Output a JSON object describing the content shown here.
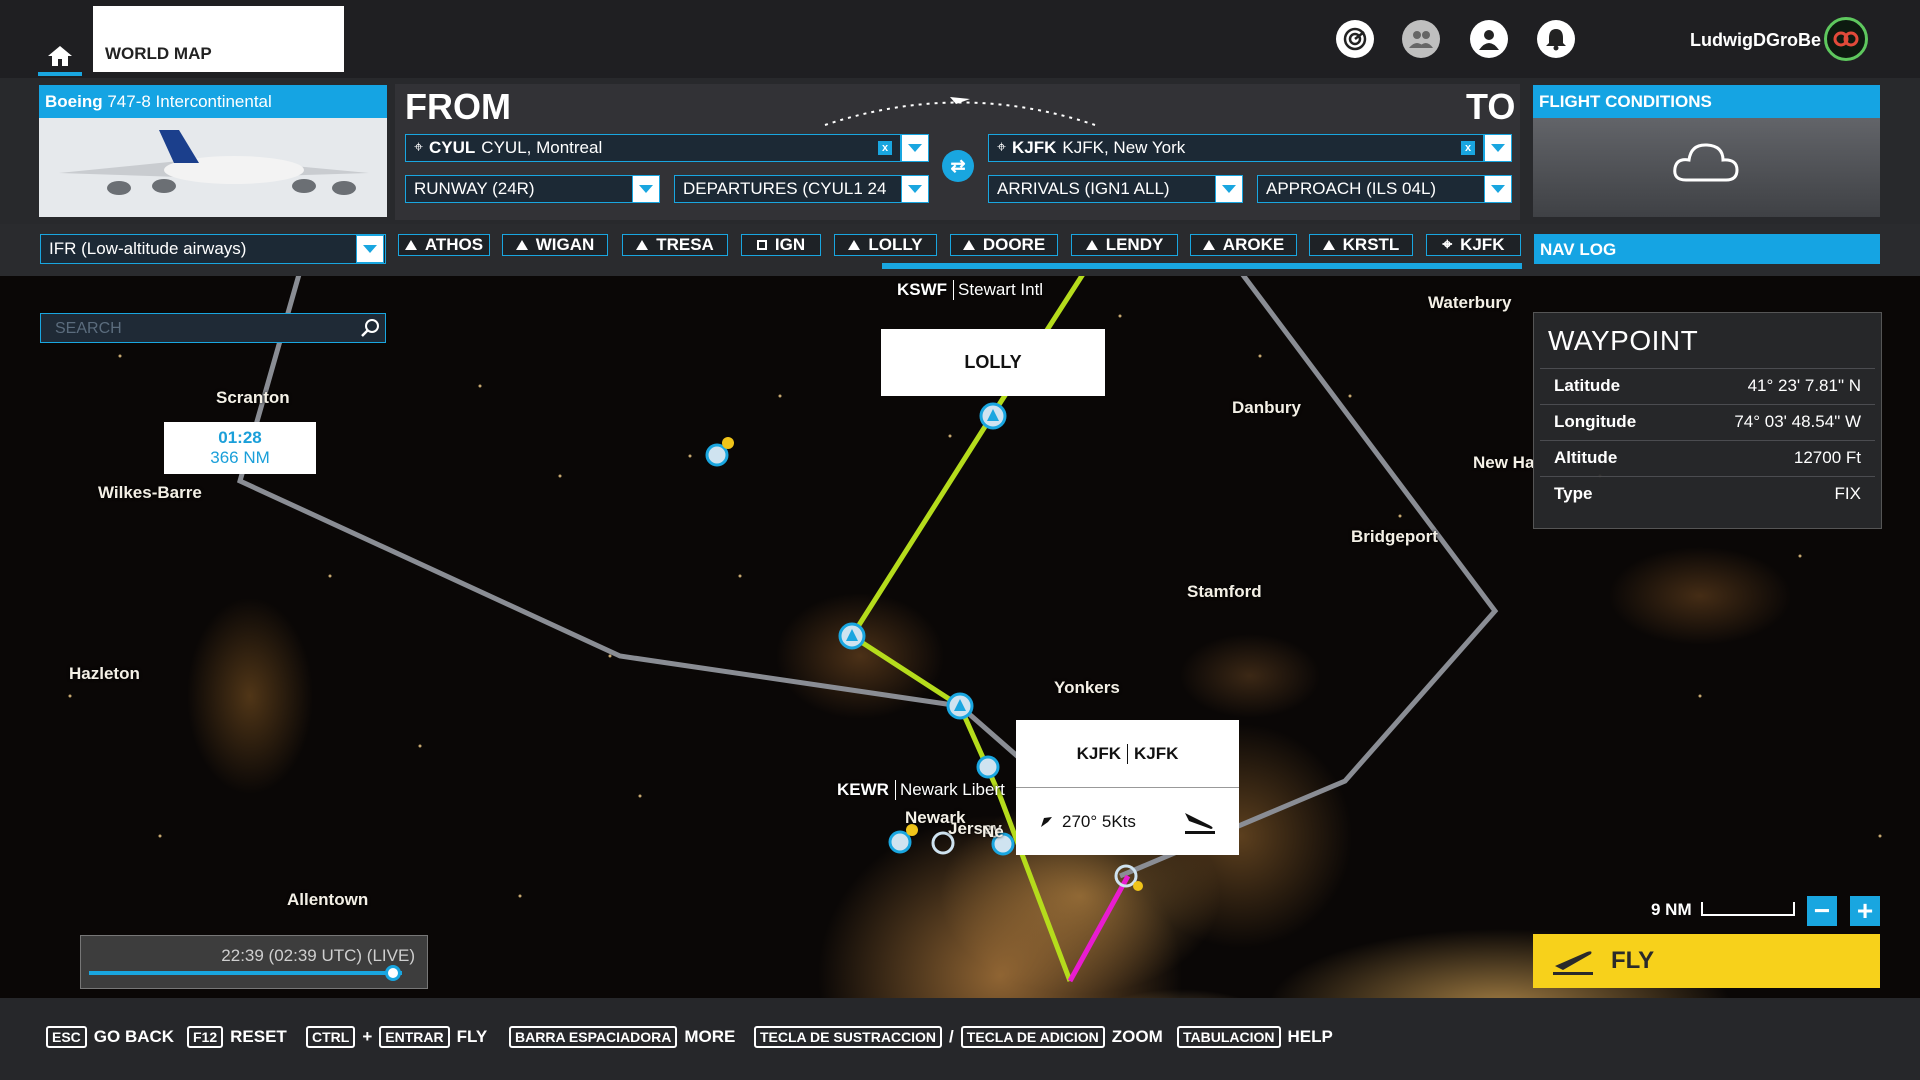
{
  "topbar": {
    "world_map_tab": "WORLD MAP",
    "username": "LudwigDGroBe",
    "icons": [
      "home-icon",
      "activity-icon",
      "group-icon",
      "profile-icon",
      "notifications-icon"
    ]
  },
  "aircraft": {
    "maker": "Boeing",
    "model": "747-8 Intercontinental"
  },
  "route": {
    "from_label": "FROM",
    "to_label": "TO",
    "from_code": "CYUL",
    "from_name": "CYUL, Montreal",
    "to_code": "KJFK",
    "to_name": "KJFK, New York",
    "runway": "RUNWAY (24R)",
    "departure": "DEPARTURES (CYUL1 24",
    "arrival": "ARRIVALS (IGN1 ALL)",
    "approach": "APPROACH (ILS 04L)",
    "clear_mark": "x"
  },
  "flight_conditions": {
    "title": "FLIGHT CONDITIONS"
  },
  "navrow": {
    "flight_type": "IFR (Low-altitude airways)",
    "navlog": "NAV LOG",
    "waypoints": [
      "ATHOS",
      "WIGAN",
      "TRESA",
      "IGN",
      "LOLLY",
      "DOORE",
      "LENDY",
      "AROKE",
      "KRSTL",
      "KJFK"
    ]
  },
  "map": {
    "search_placeholder": "SEARCH",
    "kswf_code": "KSWF",
    "kswf_name": "Stewart Intl",
    "lolly_popup": "LOLLY",
    "eta": "01:28",
    "distance": "366 NM",
    "kewr_code": "KEWR",
    "kewr_name": "Newark Libert",
    "kjfk_code": "KJFK",
    "kjfk_name": "KJFK",
    "wind": "270° 5Kts",
    "cities": {
      "scranton": "Scranton",
      "wilkes_barre": "Wilkes-Barre",
      "hazleton": "Hazleton",
      "allentown": "Allentown",
      "waterbury": "Waterbury",
      "danbury": "Danbury",
      "new_haven": "New Ha",
      "bridgeport": "Bridgeport",
      "stamford": "Stamford",
      "yonkers": "Yonkers",
      "newark": "Newark",
      "jersey": "Jersey",
      "ne": "Ne"
    },
    "scale_label": "9 NM",
    "zoom_out": "−",
    "zoom_in": "+",
    "time": "22:39 (02:39 UTC) (LIVE)",
    "time_progress": 0.97
  },
  "waypoint_panel": {
    "title": "WAYPOINT",
    "rows": [
      {
        "key": "Latitude",
        "value": "41° 23' 7.81\" N"
      },
      {
        "key": "Longitude",
        "value": "74° 03' 48.54\" W"
      },
      {
        "key": "Altitude",
        "value": "12700 Ft"
      },
      {
        "key": "Type",
        "value": "FIX"
      }
    ]
  },
  "fly_button": "FLY",
  "bottombar": {
    "esc_key": "ESC",
    "esc_label": "GO BACK",
    "f12_key": "F12",
    "f12_label": "RESET",
    "ctrl_key": "CTRL",
    "plus": "+",
    "enter_key": "ENTRAR",
    "fly_label": "FLY",
    "space_key": "BARRA ESPACIADORA",
    "more_label": "MORE",
    "minus_key": "TECLA DE SUSTRACCION",
    "slash": "/",
    "add_key": "TECLA DE ADICION",
    "zoom_label": "ZOOM",
    "tab_key": "TABULACION",
    "help_label": "HELP"
  },
  "colors": {
    "accent": "#19a6e0",
    "route_green": "#b5dc1c",
    "route_magenta": "#e81cd0",
    "airway_grey": "#8a8d94",
    "fly_yellow": "#f7d11b"
  }
}
